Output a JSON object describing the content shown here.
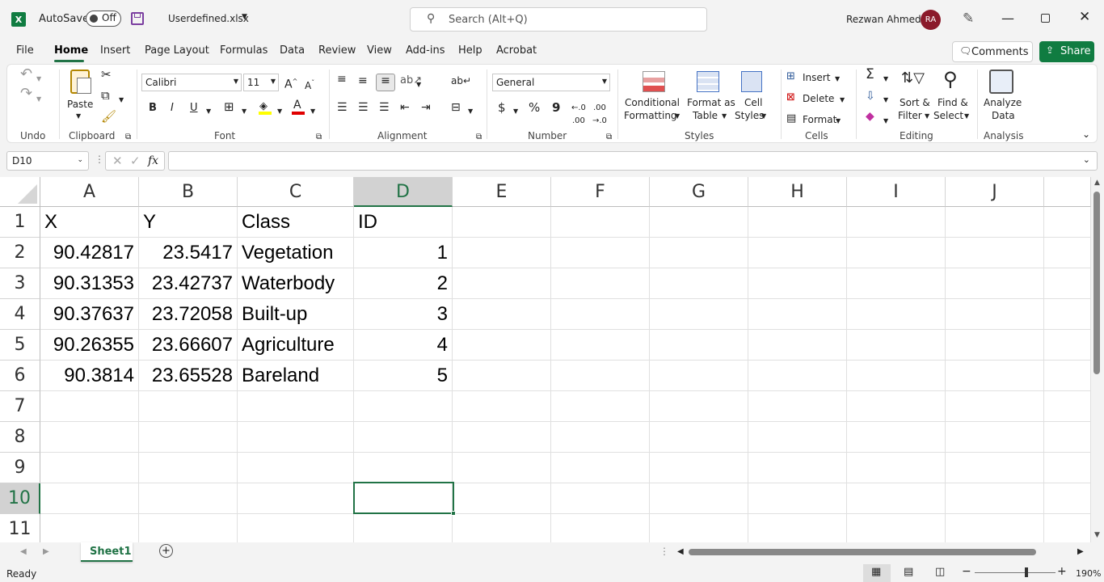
{
  "titlebar": {
    "autosave_label": "AutoSave",
    "autosave_state": "Off",
    "filename": "Userdefined.xlsx",
    "search_placeholder": "Search (Alt+Q)",
    "user_name": "Rezwan Ahmed",
    "user_initials": "RA"
  },
  "tabs": [
    "File",
    "Home",
    "Insert",
    "Page Layout",
    "Formulas",
    "Data",
    "Review",
    "View",
    "Add-ins",
    "Help",
    "Acrobat"
  ],
  "active_tab": "Home",
  "comments_label": "Comments",
  "share_label": "Share",
  "ribbon": {
    "undo_group": "Undo",
    "clipboard_group": "Clipboard",
    "paste_label": "Paste",
    "font_group": "Font",
    "font_name": "Calibri",
    "font_size": "11",
    "alignment_group": "Alignment",
    "number_group": "Number",
    "number_format": "General",
    "styles_group": "Styles",
    "conditional_formatting": [
      "Conditional",
      "Formatting"
    ],
    "format_as_table": [
      "Format as",
      "Table"
    ],
    "cell_styles": [
      "Cell",
      "Styles"
    ],
    "cells_group": "Cells",
    "insert_label": "Insert",
    "delete_label": "Delete",
    "format_label": "Format",
    "editing_group": "Editing",
    "sort_filter": [
      "Sort &",
      "Filter"
    ],
    "find_select": [
      "Find &",
      "Select"
    ],
    "analysis_group": "Analysis",
    "analyze_data": [
      "Analyze",
      "Data"
    ],
    "bold": "B",
    "italic": "I",
    "underline": "U",
    "currency": "$",
    "percent": "%",
    "comma": "9"
  },
  "name_box": "D10",
  "fx_label": "fx",
  "formula_value": "",
  "columns": [
    "A",
    "B",
    "C",
    "D",
    "E",
    "F",
    "G",
    "H",
    "I",
    "J"
  ],
  "rows": [
    "1",
    "2",
    "3",
    "4",
    "5",
    "6",
    "7",
    "8",
    "9",
    "10",
    "11"
  ],
  "cells": [
    [
      "X",
      "Y",
      "Class",
      "ID"
    ],
    [
      "90.42817",
      "23.5417",
      "Vegetation",
      "1"
    ],
    [
      "90.31353",
      "23.42737",
      "Waterbody",
      "2"
    ],
    [
      "90.37637",
      "23.72058",
      "Built-up",
      "3"
    ],
    [
      "90.26355",
      "23.66607",
      "Agriculture",
      "4"
    ],
    [
      "90.3814",
      "23.65528",
      "Bareland",
      "5"
    ]
  ],
  "selected_cell": "D10",
  "sheets": [
    "Sheet1"
  ],
  "status_text": "Ready",
  "zoom_level": "190%",
  "colors": {
    "accent": "#217346",
    "share_bg": "#107c41",
    "avatar_bg": "#8b1a2b",
    "selection": "#217346"
  }
}
